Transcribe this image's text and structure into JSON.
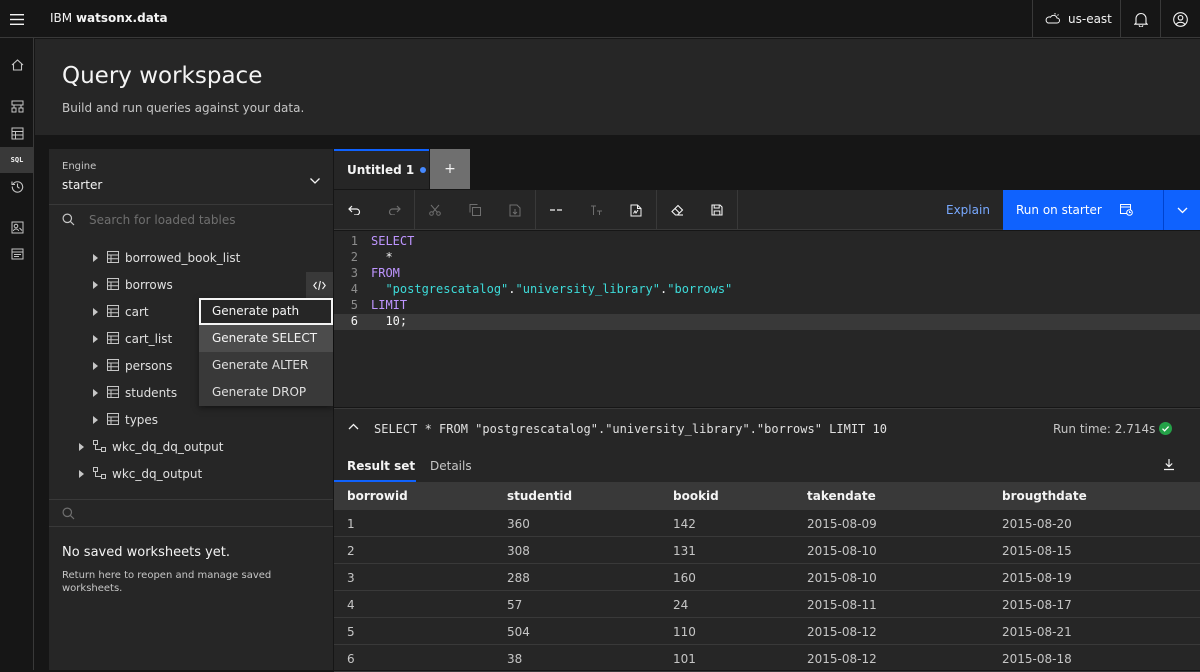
{
  "header": {
    "brand_prefix": "IBM",
    "brand_product": "watsonx.data",
    "region": "us-east"
  },
  "rail": {
    "sql_label": "SQL"
  },
  "page": {
    "title": "Query workspace",
    "subtitle": "Build and run queries against your data."
  },
  "left_panel": {
    "engine_label": "Engine",
    "engine_value": "starter",
    "search_placeholder": "Search for loaded tables",
    "tables": [
      "borrowed_book_list",
      "borrows",
      "cart",
      "cart_list",
      "persons",
      "students",
      "types"
    ],
    "schemas": [
      "wkc_dq_dq_output",
      "wkc_dq_output"
    ],
    "worksheets_empty_title": "No saved worksheets yet.",
    "worksheets_empty_desc": "Return here to reopen and manage saved worksheets."
  },
  "context_menu": {
    "items": [
      "Generate path",
      "Generate SELECT",
      "Generate ALTER",
      "Generate DROP"
    ]
  },
  "editor": {
    "tab_label": "Untitled 1",
    "add_tab": "+",
    "explain_label": "Explain",
    "run_label": "Run on starter",
    "lines": [
      {
        "n": "1",
        "parts": [
          {
            "t": "SELECT",
            "c": "kw"
          }
        ]
      },
      {
        "n": "2",
        "parts": [
          {
            "t": "  *",
            "c": "pl"
          }
        ]
      },
      {
        "n": "3",
        "parts": [
          {
            "t": "FROM",
            "c": "kw"
          }
        ]
      },
      {
        "n": "4",
        "parts": [
          {
            "t": "  ",
            "c": "pl"
          },
          {
            "t": "\"postgrescatalog\"",
            "c": "str"
          },
          {
            "t": ".",
            "c": "pl"
          },
          {
            "t": "\"university_library\"",
            "c": "str"
          },
          {
            "t": ".",
            "c": "pl"
          },
          {
            "t": "\"borrows\"",
            "c": "str"
          }
        ]
      },
      {
        "n": "5",
        "parts": [
          {
            "t": "LIMIT",
            "c": "kw"
          }
        ]
      },
      {
        "n": "6",
        "parts": [
          {
            "t": "  10;",
            "c": "pl"
          }
        ]
      }
    ]
  },
  "query_summary": {
    "text": "SELECT * FROM \"postgrescatalog\".\"university_library\".\"borrows\" LIMIT 10",
    "run_time": "Run time: 2.714s"
  },
  "results": {
    "tab_resultset": "Result set",
    "tab_details": "Details",
    "columns": [
      "borrowid",
      "studentid",
      "bookid",
      "takendate",
      "brougthdate"
    ],
    "rows": [
      [
        "1",
        "360",
        "142",
        "2015-08-09",
        "2015-08-20"
      ],
      [
        "2",
        "308",
        "131",
        "2015-08-10",
        "2015-08-15"
      ],
      [
        "3",
        "288",
        "160",
        "2015-08-10",
        "2015-08-19"
      ],
      [
        "4",
        "57",
        "24",
        "2015-08-11",
        "2015-08-17"
      ],
      [
        "5",
        "504",
        "110",
        "2015-08-12",
        "2015-08-21"
      ],
      [
        "6",
        "38",
        "101",
        "2015-08-12",
        "2015-08-18"
      ]
    ]
  },
  "colors": {
    "accent": "#0f62fe",
    "keyword": "#be95ff",
    "string": "#3ddbd9",
    "success": "#24a148"
  }
}
